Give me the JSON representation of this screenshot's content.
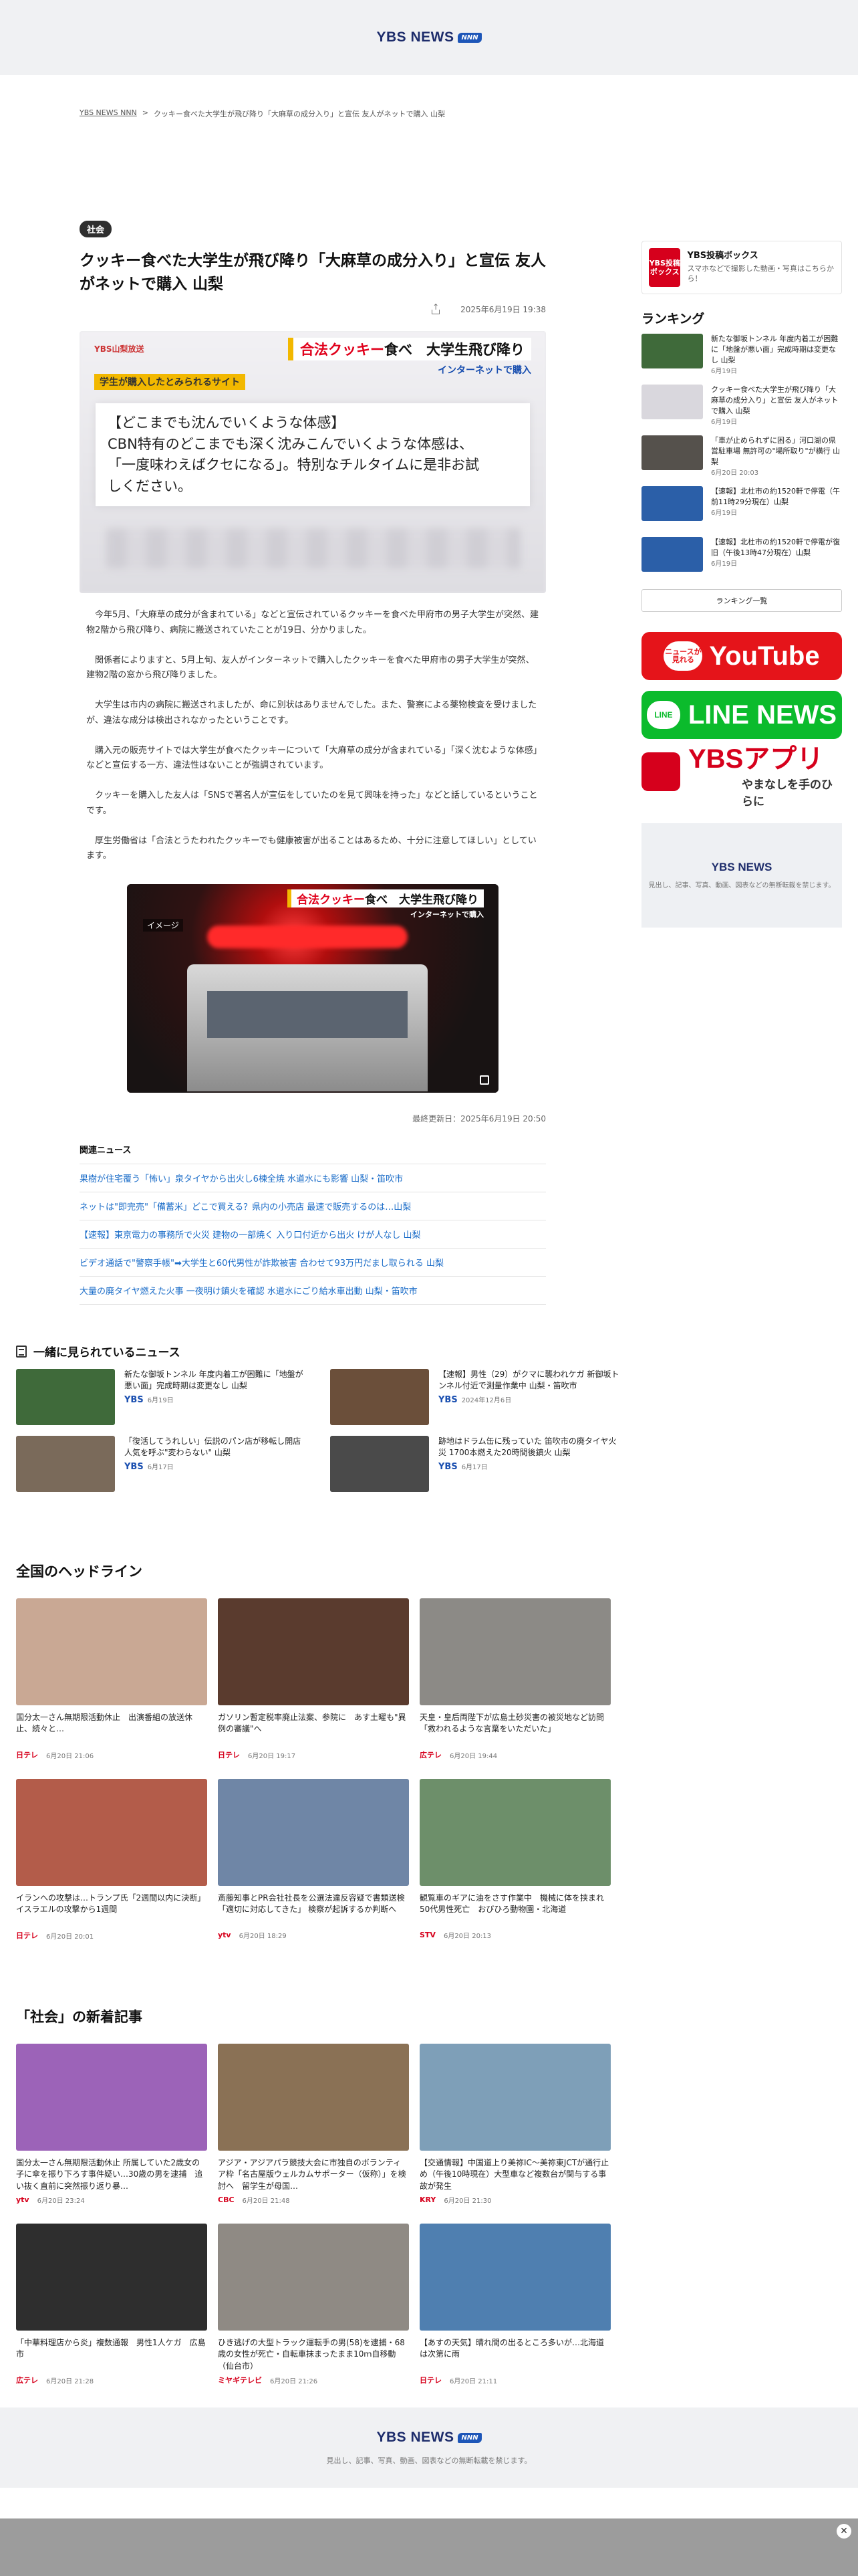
{
  "header": {
    "logo": "YBS NEWS",
    "logo_badge": "NNN"
  },
  "breadcrumb": {
    "home": "YBS NEWS NNN",
    "separator": ">",
    "current": "クッキー食べた大学生が飛び降り「大麻草の成分入り」と宣伝 友人がネットで購入 山梨"
  },
  "article": {
    "category": "社会",
    "title": "クッキー食べた大学生が飛び降り「大麻草の成分入り」と宣伝 友人がネットで購入 山梨",
    "date": "2025年6月19日 19:38",
    "hero": {
      "station": "YBS山梨放送",
      "telop_main_highlight": "合法クッキー",
      "telop_main_rest": "食べ　大学生飛び降り",
      "telop_sub": "インターネットで購入",
      "tag": "学生が購入したとみられるサイト",
      "quote_lines": [
        "【どこまでも沈んでいくような体感】",
        "CBN特有のどこまでも深く沈みこんでいくような体感は、",
        "「一度味わえばクセになる」。特別なチルタイムに是非お試",
        "しください。"
      ]
    },
    "paragraphs": [
      "今年5月、「大麻草の成分が含まれている」などと宣伝されているクッキーを食べた甲府市の男子大学生が突然、建物2階から飛び降り、病院に搬送されていたことが19日、分かりました。",
      "関係者によりますと、5月上旬、友人がインターネットで購入したクッキーを食べた甲府市の男子大学生が突然、建物2階の窓から飛び降りました。",
      "大学生は市内の病院に搬送されましたが、命に別状はありませんでした。また、警察による薬物検査を受けましたが、違法な成分は検出されなかったということです。",
      "購入元の販売サイトでは大学生が食べたクッキーについて「大麻草の成分が含まれている」「深く沈むような体感」などと宣伝する一方、違法性はないことが強調されています。",
      "クッキーを購入した友人は「SNSで著名人が宣伝をしていたのを見て興味を持った」などと話しているということです。",
      "厚生労働省は「合法とうたわれたクッキーでも健康被害が出ることはあるため、十分に注意してほしい」としています。"
    ],
    "video": {
      "telop_highlight": "合法クッキー",
      "telop_rest": "食べ　大学生飛び降り",
      "telop_sub": "インターネットで購入",
      "label": "イメージ"
    },
    "updated": "最終更新日：2025年6月19日 20:50",
    "related_title": "関連ニュース",
    "related": [
      "果樹が住宅覆う「怖い」泉タイヤから出火し6棟全焼 水道水にも影響 山梨・笛吹市",
      "ネットは\"即完売\"「備蓄米」どこで買える？県内の小売店 最速で販売するのは…山梨",
      "【速報】東京電力の事務所で火災 建物の一部焼く 入り口付近から出火 けが人なし 山梨",
      "ビデオ通話で\"警察手帳\"➡大学生と60代男性が詐欺被害 合わせて93万円だまし取られる 山梨",
      "大量の廃タイヤ燃えた火事 一夜明け鎮火を確認 水道水にごり給水車出動 山梨・笛吹市"
    ]
  },
  "sidebar": {
    "post_box": {
      "icon_text": "YBS投稿ボックス",
      "title": "YBS投稿ボックス",
      "sub": "スマホなどで撮影した動画・写真はこちらから！"
    },
    "ranking_title": "ランキング",
    "ranking": [
      {
        "title": "新たな御坂トンネル 年度内着工が困難に「地盤が悪い面」完成時期は変更なし 山梨",
        "date": "6月19日"
      },
      {
        "title": "クッキー食べた大学生が飛び降り「大麻草の成分入り」と宣伝 友人がネットで購入 山梨",
        "date": "6月19日"
      },
      {
        "title": "「車が止められずに困る」河口湖の県営駐車場 無許可の\"場所取り\"が横行 山梨",
        "date": "6月20日 20:03"
      },
      {
        "title": "【速報】北杜市の約1520軒で停電（午前11時29分現在）山梨",
        "date": "6月19日"
      },
      {
        "title": "【速報】北杜市の約1520軒で停電が復旧（午後13時47分現在）山梨",
        "date": "6月19日"
      }
    ],
    "ranking_more": "ランキング一覧",
    "youtube_badge": "ニュースが見れる",
    "youtube": "YouTube",
    "line_badge": "LINE",
    "line": "LINE NEWS",
    "app": "YBSアプリ",
    "app_sub": "やまなしを手のひらに",
    "ad_logo": "YBS NEWS",
    "ad_text": "見出し、記事、写真、動画、図表などの無断転載を禁じます。"
  },
  "together": {
    "title": "一緒に見られているニュース",
    "items": [
      {
        "title": "新たな御坂トンネル 年度内着工が困難に「地盤が悪い面」完成時期は変更なし 山梨",
        "src": "YBS",
        "date": "6月19日",
        "color": "#3f6a3a"
      },
      {
        "title": "【速報】男性（29）がクマに襲われケガ 新御坂トンネル付近で測量作業中 山梨・笛吹市",
        "src": "YBS",
        "date": "2024年12月6日",
        "color": "#6b4f3a"
      },
      {
        "title": "「復活してうれしい」伝説のパン店が移転し開店 人気を呼ぶ\"変わらない\" 山梨",
        "src": "YBS",
        "date": "6月17日",
        "color": "#7a6a5a"
      },
      {
        "title": "跡地はドラム缶に残っていた 笛吹市の廃タイヤ火災 1700本燃えた20時間後鎮火 山梨",
        "src": "YBS",
        "date": "6月17日",
        "color": "#4a4a4a"
      }
    ]
  },
  "headlines": {
    "title": "全国のヘッドライン",
    "items": [
      {
        "title": "国分太一さん無期限活動休止　出演番組の放送休止、続々と…",
        "src": "日テレ",
        "date": "6月20日 21:06",
        "color": "#c9a894"
      },
      {
        "title": "ガソリン暫定税率廃止法案、参院に　あす土曜も\"異例の審議\"へ",
        "src": "日テレ",
        "date": "6月20日 19:17",
        "color": "#5a3b2e"
      },
      {
        "title": "天皇・皇后両陛下が広島土砂災害の被災地など訪問「救われるような言葉をいただいた」",
        "src": "広テレ",
        "date": "6月20日 19:44",
        "color": "#8c8a86"
      },
      {
        "title": "イランへの攻撃は…トランプ氏「2週間以内に決断」 イスラエルの攻撃から1週間",
        "src": "日テレ",
        "date": "6月20日 20:01",
        "color": "#b35c4a"
      },
      {
        "title": "斎藤知事とPR会社社長を公選法違反容疑で書類送検「適切に対応してきた」 検察が起訴するか判断へ",
        "src": "ytv",
        "date": "6月20日 18:29",
        "color": "#6f86a6"
      },
      {
        "title": "観覧車のギアに油をさす作業中　機械に体を挟まれ50代男性死亡　おびひろ動物園・北海道",
        "src": "STV",
        "date": "6月20日 20:13",
        "color": "#6d8f6a"
      }
    ]
  },
  "social": {
    "title": "「社会」の新着記事",
    "items": [
      {
        "title": "国分太一さん無期限活動休止 所属していた2歳女の子に傘を振り下ろす事件疑い…30歳の男を逮捕　追い抜く直前に突然振り返り暴…",
        "src": "ytv",
        "date": "6月20日 23:24",
        "color": "#9c63b8"
      },
      {
        "title": "アジア・アジアパラ競技大会に市独自のボランティア枠「名古屋版ウェルカムサポーター（仮称）」を検討へ　留学生が母国…",
        "src": "CBC",
        "date": "6月20日 21:48",
        "color": "#8a7155"
      },
      {
        "title": "【交通情報】中国道上り美祢IC～美祢東JCTが通行止め（午後10時現在）大型車など複数台が関与する事故が発生",
        "src": "KRY",
        "date": "6月20日 21:30",
        "color": "#7e9fb8"
      },
      {
        "title": "「中華料理店から炎」複数通報　男性1人ケガ　広島市",
        "src": "広テレ",
        "date": "6月20日 21:28",
        "color": "#2e2e2e"
      },
      {
        "title": "ひき逃げの大型トラック運転手の男(58)を逮捕・68歳の女性が死亡・自転車抹まったまま10ｍ自移動（仙台市）",
        "src": "ミヤギテレビ",
        "date": "6月20日 21:26",
        "color": "#8f8a84"
      },
      {
        "title": "【あすの天気】晴れ間の出るところ多いが…北海道は次第に雨",
        "src": "日テレ",
        "date": "6月20日 21:11",
        "color": "#4f7fb0"
      }
    ]
  },
  "footer": {
    "logo": "YBS NEWS",
    "badge": "NNN",
    "text": "見出し、記事、写真、動画、図表などの無断転載を禁じます。"
  }
}
